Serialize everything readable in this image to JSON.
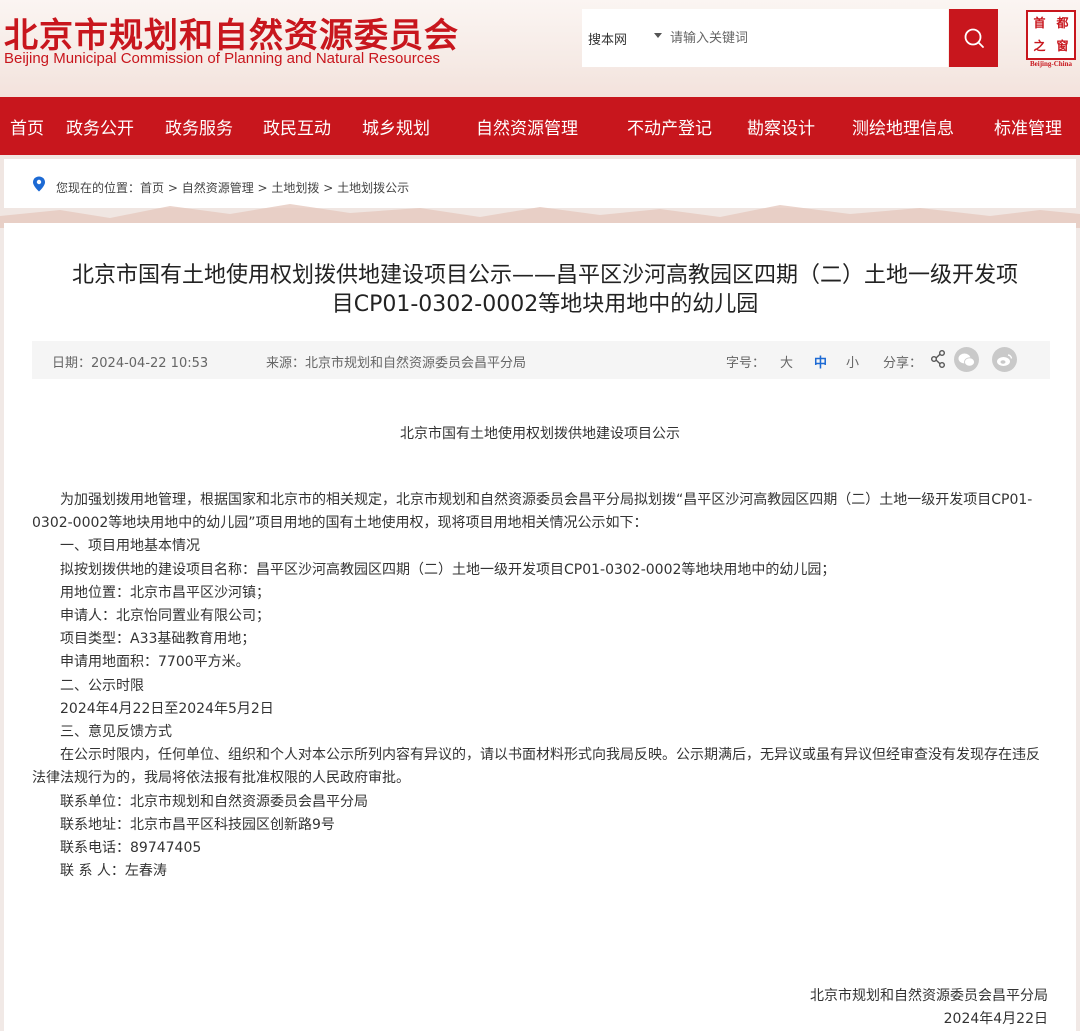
{
  "header": {
    "title_cn": "北京市规划和自然资源委员会",
    "title_en": "Beijing Municipal Commission of Planning and Natural Resources",
    "search_scope": "搜本网",
    "search_placeholder": "请输入关键词",
    "seal_chars": [
      "首",
      "都",
      "之",
      "窗"
    ],
    "seal_caption": "Beijing-China"
  },
  "nav": {
    "items": [
      "首页",
      "政务公开",
      "政务服务",
      "政民互动",
      "城乡规划",
      "自然资源管理",
      "不动产登记",
      "勘察设计",
      "测绘地理信息",
      "标准管理"
    ]
  },
  "breadcrumb": {
    "prefix": "您现在的位置：",
    "items": [
      "首页",
      "自然资源管理",
      "土地划拨",
      "土地划拨公示"
    ],
    "separator": " > "
  },
  "article": {
    "title_line1": "北京市国有土地使用权划拨供地建设项目公示——昌平区沙河高教园区四期（二）土地一级开发项",
    "title_line2": "目CP01-0302-0002等地块用地中的幼儿园",
    "date": "日期：2024-04-22 10:53",
    "source": "来源：北京市规划和自然资源委员会昌平分局",
    "font_size_label": "字号：",
    "font_sizes": [
      "大",
      "中",
      "小"
    ],
    "share_label": "分享：",
    "doc_heading": "北京市国有土地使用权划拨供地建设项目公示",
    "intro": "为加强划拨用地管理，根据国家和北京市的相关规定，北京市规划和自然资源委员会昌平分局拟划拨“昌平区沙河高教园区四期（二）土地一级开发项目CP01-0302-0002等地块用地中的幼儿园”项目用地的国有土地使用权，现将项目用地相关情况公示如下：",
    "lines": [
      "一、项目用地基本情况",
      "拟按划拨供地的建设项目名称：昌平区沙河高教园区四期（二）土地一级开发项目CP01-0302-0002等地块用地中的幼儿园；",
      "用地位置：北京市昌平区沙河镇；",
      "申请人：北京怡同置业有限公司；",
      "项目类型：A33基础教育用地；",
      "申请用地面积：7700平方米。",
      "二、公示时限",
      "2024年4月22日至2024年5月2日",
      "三、意见反馈方式"
    ],
    "feedback": "在公示时限内，任何单位、组织和个人对本公示所列内容有异议的，请以书面材料形式向我局反映。公示期满后，无异议或虽有异议但经审查没有发现存在违反法律法规行为的，我局将依法报有批准权限的人民政府审批。",
    "contacts": [
      "联系单位：北京市规划和自然资源委员会昌平分局",
      "联系地址：北京市昌平区科技园区创新路9号",
      "联系电话：89747405",
      "联 系 人：左春涛"
    ],
    "signature_org": "北京市规划和自然资源委员会昌平分局",
    "signature_date": "2024年4月22日"
  },
  "colors": {
    "brand_red": "#c8161d",
    "active_font_size": "#1d6ad4"
  }
}
